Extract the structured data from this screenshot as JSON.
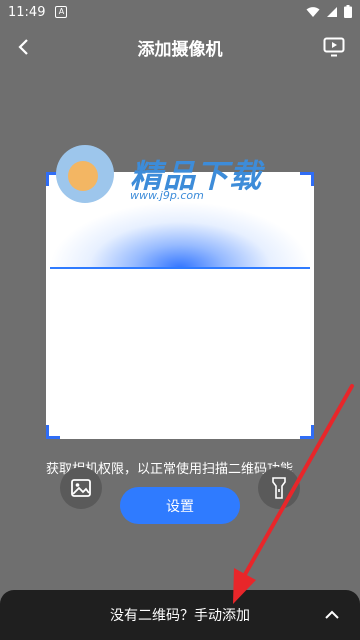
{
  "status_bar": {
    "time": "11:49",
    "notif_glyph": "A"
  },
  "app_bar": {
    "title": "添加摄像机"
  },
  "watermark": {
    "brand": "精品下载",
    "url": "www.j9p.com"
  },
  "scanner": {
    "hint": "获取相机权限，以正常使用扫描二维码功能"
  },
  "actions": {
    "settings_label": "设置"
  },
  "bottom_sheet": {
    "label": "没有二维码？手动添加"
  },
  "colors": {
    "accent": "#2f7bff",
    "annotation_arrow": "#e8262a"
  }
}
